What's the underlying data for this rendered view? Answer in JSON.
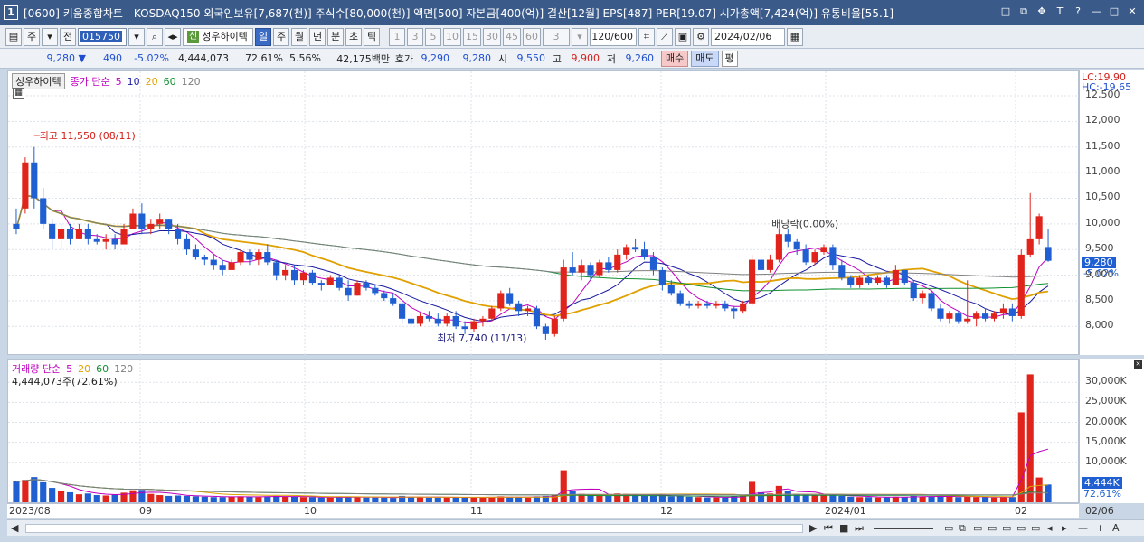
{
  "window": {
    "app_no": "1",
    "title": "[0600] 키움종합차트 - KOSDAQ150 외국인보유[7,687(천)] 주식수[80,000(천)] 액면[500] 자본금[400(억)] 결산[12월] EPS[487] PER[19.07] 시가총액[7,424(억)] 유통비율[55.1]",
    "controls": [
      "□",
      "⧉",
      "✥",
      "T",
      "?",
      "—",
      "□",
      "✕"
    ]
  },
  "toolbar": {
    "type_select": "주",
    "prev_btn": "전",
    "code": "015750",
    "stock_badge": "신",
    "stock_name": "성우하이텍",
    "periods": [
      "일",
      "주",
      "월",
      "년",
      "분",
      "초",
      "틱"
    ],
    "active_period": "일",
    "intervals": [
      "1",
      "3",
      "5",
      "10",
      "15",
      "30",
      "45",
      "60"
    ],
    "interval_value": "3",
    "count": "120/600",
    "date": "2024/02/06"
  },
  "quote": {
    "price": "9,280 ▼",
    "change": "490",
    "change_pct": "-5.02%",
    "volume": "4,444,073",
    "vol_ratio": "72.61%",
    "turnover": "5.56%",
    "amount": "42,175백만",
    "ask_label": "호가",
    "ask": "9,290",
    "bid": "9,280",
    "open_label": "시",
    "open": "9,550",
    "high_label": "고",
    "high": "9,900",
    "low_label": "저",
    "low": "9,260",
    "buy": "매수",
    "sell": "매도",
    "flat": "평"
  },
  "price_panel": {
    "stock_label": "성우하이텍",
    "legend_prefix": "종가 단순",
    "ma_labels": [
      "5",
      "10",
      "20",
      "60",
      "120"
    ],
    "ma_colors": [
      "#c000c0",
      "#1a1aa0",
      "#e0a000",
      "#109030",
      "#808080"
    ],
    "lc": "LC:19.90",
    "hc": "HC:-19.65",
    "high_note": "최고 11,550 (08/11)",
    "low_note": "최저 7,740 (11/13)",
    "dividend_note": "배당락(0.00%)",
    "price_tag": "9,280",
    "pct_tag": "-5.02%",
    "y_ticks": [
      "12,500",
      "12,000",
      "11,500",
      "11,000",
      "10,500",
      "10,000",
      "9,500",
      "9,000",
      "8,500",
      "8,000"
    ]
  },
  "volume_panel": {
    "legend": "거래량 단순",
    "ma_labels": [
      "5",
      "20",
      "60",
      "120"
    ],
    "ma_colors": [
      "#c000c0",
      "#e0a000",
      "#109030",
      "#808080"
    ],
    "info": "4,444,073주(72.61%)",
    "vol_tag": "4,444K",
    "pct_tag": "72.61%",
    "y_ticks": [
      "30,000K",
      "25,000K",
      "20,000K",
      "15,000K",
      "10,000K"
    ]
  },
  "x_labels": [
    "2023/08",
    "09",
    "10",
    "11",
    "12",
    "2024/01",
    "02",
    "02/06"
  ],
  "colors": {
    "up": "#e0241b",
    "down": "#1f5fd1"
  },
  "chart_data": {
    "type": "candlestick",
    "period": "daily",
    "ylim": [
      7600,
      12800
    ],
    "volume_ylim": [
      0,
      33000
    ],
    "candles": [
      [
        10000,
        10300,
        9800,
        9900,
        5200
      ],
      [
        10300,
        11300,
        10200,
        11200,
        5600
      ],
      [
        11200,
        11500,
        10300,
        10500,
        6300
      ],
      [
        10500,
        10700,
        9900,
        10000,
        5000
      ],
      [
        10000,
        10100,
        9500,
        9700,
        3600
      ],
      [
        9700,
        10000,
        9500,
        9900,
        2800
      ],
      [
        9900,
        10000,
        9600,
        9700,
        2500
      ],
      [
        9700,
        10000,
        9700,
        9900,
        2000
      ],
      [
        9900,
        10000,
        9600,
        9700,
        2200
      ],
      [
        9700,
        9800,
        9600,
        9650,
        1800
      ],
      [
        9650,
        9800,
        9500,
        9700,
        1700
      ],
      [
        9700,
        9800,
        9500,
        9600,
        1900
      ],
      [
        9600,
        10000,
        9600,
        9900,
        2400
      ],
      [
        9900,
        10300,
        9900,
        10200,
        3000
      ],
      [
        10200,
        10400,
        9800,
        9900,
        3100
      ],
      [
        9900,
        10100,
        9800,
        10000,
        2100
      ],
      [
        10000,
        10200,
        9900,
        10100,
        1800
      ],
      [
        10100,
        10100,
        9800,
        9900,
        1600
      ],
      [
        9900,
        10000,
        9600,
        9700,
        1700
      ],
      [
        9700,
        9800,
        9400,
        9500,
        1600
      ],
      [
        9500,
        9600,
        9300,
        9350,
        1500
      ],
      [
        9350,
        9400,
        9200,
        9300,
        1400
      ],
      [
        9300,
        9400,
        9100,
        9200,
        1300
      ],
      [
        9200,
        9300,
        9000,
        9100,
        1300
      ],
      [
        9100,
        9300,
        9100,
        9250,
        1400
      ],
      [
        9250,
        9500,
        9200,
        9450,
        1500
      ],
      [
        9450,
        9500,
        9200,
        9300,
        1400
      ],
      [
        9300,
        9500,
        9200,
        9450,
        1300
      ],
      [
        9450,
        9600,
        9200,
        9250,
        1500
      ],
      [
        9250,
        9300,
        8900,
        9000,
        1600
      ],
      [
        9000,
        9200,
        8900,
        9100,
        1400
      ],
      [
        9100,
        9200,
        8800,
        8900,
        1400
      ],
      [
        8900,
        9100,
        8800,
        9050,
        1300
      ],
      [
        9050,
        9100,
        8800,
        8850,
        1300
      ],
      [
        8850,
        8900,
        8700,
        8800,
        1200
      ],
      [
        8800,
        9000,
        8800,
        8950,
        1200
      ],
      [
        8950,
        9000,
        8700,
        8750,
        1300
      ],
      [
        8750,
        8900,
        8500,
        8600,
        1400
      ],
      [
        8600,
        8900,
        8600,
        8850,
        1300
      ],
      [
        8850,
        8900,
        8700,
        8750,
        1200
      ],
      [
        8750,
        8800,
        8600,
        8650,
        1200
      ],
      [
        8650,
        8700,
        8500,
        8550,
        1200
      ],
      [
        8550,
        8650,
        8400,
        8450,
        1100
      ],
      [
        8450,
        8500,
        8050,
        8150,
        1600
      ],
      [
        8150,
        8250,
        8000,
        8050,
        1400
      ],
      [
        8050,
        8250,
        8000,
        8200,
        1300
      ],
      [
        8200,
        8300,
        8100,
        8150,
        1200
      ],
      [
        8150,
        8250,
        8000,
        8050,
        1200
      ],
      [
        8050,
        8250,
        8000,
        8200,
        1200
      ],
      [
        8200,
        8300,
        7950,
        8000,
        1300
      ],
      [
        8000,
        8100,
        7850,
        7950,
        1200
      ],
      [
        7950,
        8150,
        7900,
        8100,
        1300
      ],
      [
        8100,
        8200,
        8000,
        8150,
        1200
      ],
      [
        8150,
        8400,
        8100,
        8350,
        1300
      ],
      [
        8350,
        8700,
        8300,
        8650,
        1500
      ],
      [
        8650,
        8750,
        8400,
        8450,
        1300
      ],
      [
        8450,
        8500,
        8200,
        8300,
        1300
      ],
      [
        8300,
        8400,
        8200,
        8350,
        1200
      ],
      [
        8350,
        8400,
        7950,
        8000,
        1500
      ],
      [
        8000,
        8050,
        7740,
        7850,
        1600
      ],
      [
        7850,
        8200,
        7800,
        8150,
        1800
      ],
      [
        8150,
        9300,
        8100,
        9150,
        8000
      ],
      [
        9150,
        9450,
        9000,
        9050,
        2800
      ],
      [
        9050,
        9300,
        8900,
        9200,
        2100
      ],
      [
        9200,
        9250,
        8900,
        9000,
        1800
      ],
      [
        9000,
        9300,
        8950,
        9250,
        1700
      ],
      [
        9250,
        9350,
        9050,
        9100,
        1600
      ],
      [
        9100,
        9500,
        9050,
        9400,
        2200
      ],
      [
        9400,
        9600,
        9300,
        9550,
        2100
      ],
      [
        9550,
        9700,
        9450,
        9500,
        1800
      ],
      [
        9500,
        9650,
        9300,
        9350,
        1600
      ],
      [
        9350,
        9450,
        9000,
        9100,
        1700
      ],
      [
        9100,
        9150,
        8700,
        8800,
        1800
      ],
      [
        8800,
        8900,
        8600,
        8650,
        1500
      ],
      [
        8650,
        8700,
        8400,
        8450,
        1600
      ],
      [
        8450,
        8500,
        8350,
        8400,
        1400
      ],
      [
        8400,
        8500,
        8350,
        8450,
        1300
      ],
      [
        8450,
        8500,
        8350,
        8400,
        1200
      ],
      [
        8400,
        8500,
        8350,
        8450,
        1200
      ],
      [
        8450,
        8500,
        8300,
        8350,
        1200
      ],
      [
        8350,
        8400,
        8150,
        8300,
        1500
      ],
      [
        8300,
        8500,
        8250,
        8450,
        1600
      ],
      [
        8450,
        9400,
        8400,
        9300,
        5100
      ],
      [
        9300,
        9500,
        9050,
        9100,
        2500
      ],
      [
        9100,
        9400,
        9050,
        9300,
        2200
      ],
      [
        9300,
        9900,
        9250,
        9800,
        4100
      ],
      [
        9800,
        9900,
        9550,
        9650,
        2800
      ],
      [
        9650,
        9700,
        9400,
        9500,
        2100
      ],
      [
        9500,
        9600,
        9200,
        9250,
        1900
      ],
      [
        9250,
        9500,
        9200,
        9450,
        1800
      ],
      [
        9450,
        9600,
        9400,
        9550,
        1700
      ],
      [
        9550,
        9600,
        9100,
        9200,
        1800
      ],
      [
        9200,
        9300,
        8900,
        8950,
        1600
      ],
      [
        8950,
        9000,
        8750,
        8800,
        1400
      ],
      [
        8800,
        9000,
        8750,
        8950,
        1300
      ],
      [
        8950,
        9000,
        8800,
        8850,
        1300
      ],
      [
        8850,
        9000,
        8800,
        8950,
        1200
      ],
      [
        8950,
        9000,
        8750,
        8800,
        1300
      ],
      [
        8800,
        9200,
        8800,
        9100,
        1400
      ],
      [
        9100,
        9100,
        8800,
        8850,
        1300
      ],
      [
        8850,
        8900,
        8500,
        8550,
        1600
      ],
      [
        8550,
        8700,
        8450,
        8650,
        1400
      ],
      [
        8650,
        8700,
        8300,
        8350,
        1500
      ],
      [
        8350,
        8450,
        8100,
        8150,
        1600
      ],
      [
        8150,
        8300,
        8050,
        8250,
        1400
      ],
      [
        8250,
        8300,
        8050,
        8100,
        1300
      ],
      [
        8100,
        8900,
        8050,
        8150,
        1500
      ],
      [
        8150,
        8300,
        8000,
        8250,
        1300
      ],
      [
        8250,
        8350,
        8100,
        8150,
        1300
      ],
      [
        8150,
        8300,
        8100,
        8250,
        1200
      ],
      [
        8250,
        8450,
        8150,
        8350,
        1400
      ],
      [
        8350,
        8450,
        8100,
        8200,
        1300
      ],
      [
        8200,
        9500,
        8150,
        9400,
        22500
      ],
      [
        9400,
        10600,
        9350,
        9700,
        32000
      ],
      [
        9700,
        10200,
        9600,
        10150,
        6200
      ],
      [
        9550,
        9900,
        9260,
        9280,
        4444
      ]
    ]
  }
}
